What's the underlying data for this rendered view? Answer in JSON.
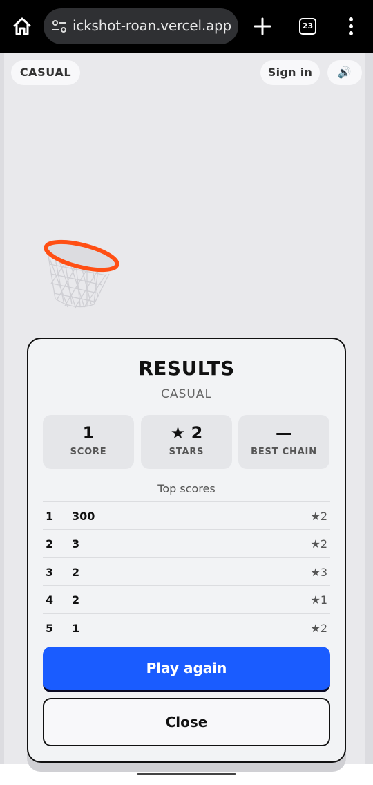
{
  "browser": {
    "url": "ickshot-roan.vercel.app",
    "tab_count": "23"
  },
  "game": {
    "mode_label": "CASUAL",
    "signin_label": "Sign in",
    "sound_icon": "🔊"
  },
  "results": {
    "title": "RESULTS",
    "mode": "CASUAL",
    "stats": {
      "score": {
        "value": "1",
        "label": "SCORE"
      },
      "stars": {
        "value": "★ 2",
        "label": "STARS"
      },
      "chain": {
        "value": "—",
        "label": "BEST CHAIN"
      }
    },
    "top_scores_heading": "Top scores",
    "top_scores": [
      {
        "rank": "1",
        "score": "300",
        "stars": "★2"
      },
      {
        "rank": "2",
        "score": "3",
        "stars": "★2"
      },
      {
        "rank": "3",
        "score": "2",
        "stars": "★3"
      },
      {
        "rank": "4",
        "score": "2",
        "stars": "★1"
      },
      {
        "rank": "5",
        "score": "1",
        "stars": "★2"
      }
    ],
    "play_again_label": "Play again",
    "close_label": "Close"
  },
  "colors": {
    "accent_blue": "#1a5cff",
    "hoop_rim": "#ff4f14"
  }
}
